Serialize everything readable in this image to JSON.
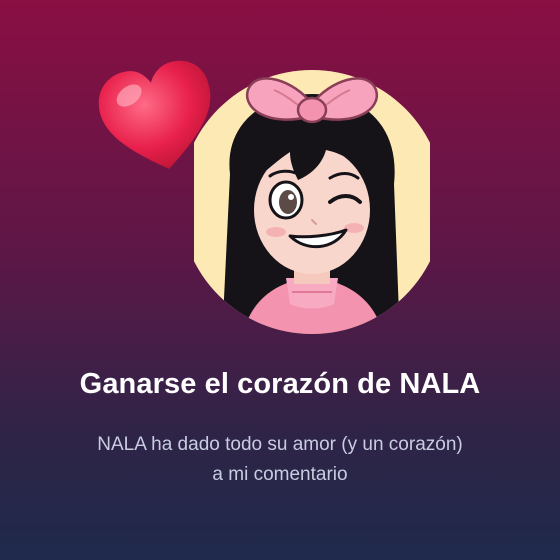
{
  "achievement": {
    "title": "Ganarse el corazón de NALA",
    "description": "NALA ha dado todo su amor (y un corazón) a mi comentario"
  },
  "icons": {
    "avatar": "nala-avatar-icon",
    "heart": "heart-icon"
  },
  "colors": {
    "background_top": "#8a0f43",
    "background_bottom": "#1f2a4c",
    "avatar_circle": "#fde9b4",
    "heart": "#e8204c",
    "bow": "#f7a3bd"
  }
}
